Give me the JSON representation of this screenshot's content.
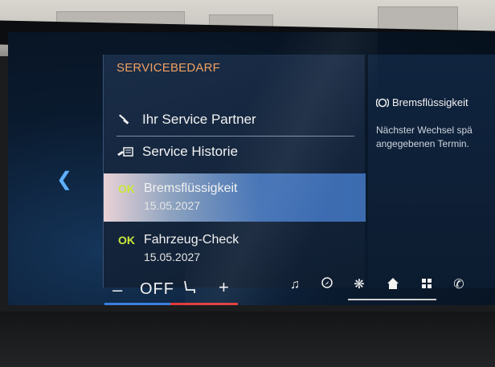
{
  "menu": {
    "title": "SERVICEBEDARF",
    "items": [
      {
        "icon": "wrench-icon",
        "label": "Ihr Service Partner"
      },
      {
        "icon": "service-book-icon",
        "label": "Service Historie"
      }
    ]
  },
  "services": [
    {
      "status": "OK",
      "name": "Bremsflüssigkeit",
      "date": "15.05.2027",
      "selected": true
    },
    {
      "status": "OK",
      "name": "Fahrzeug-Check",
      "date": "15.05.2027",
      "selected": false
    }
  ],
  "info": {
    "icon": "brake-warning-icon",
    "title": "Bremsflüssigkeit",
    "text_line1": "Nächster Wechsel spä",
    "text_line2": "angegebenen Termin."
  },
  "climate": {
    "minus": "–",
    "fan": "OFF",
    "plus": "+"
  },
  "shortcuts": [
    "music-icon",
    "navigation-icon",
    "fan-icon",
    "home-icon",
    "apps-grid-icon",
    "phone-icon"
  ],
  "colors": {
    "accent_orange": "#f0a060",
    "ok_green": "#c9e83a",
    "selection_blue": "#3c6bb0",
    "back_arrow": "#5fb0ff"
  }
}
